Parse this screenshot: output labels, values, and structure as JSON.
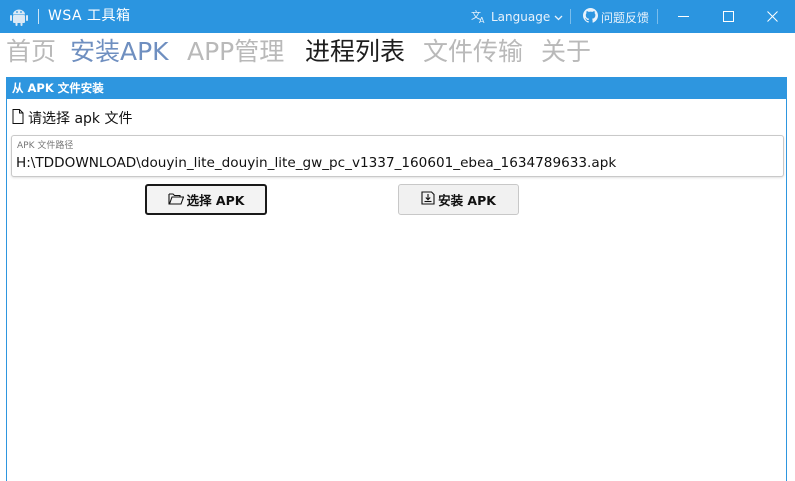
{
  "titlebar": {
    "title": "WSA 工具箱",
    "app_icon": "android-icon",
    "language_label": "Language",
    "feedback_label": "问题反馈",
    "bg_color": "#2b95e0"
  },
  "nav": {
    "items": [
      {
        "label": "首页",
        "state": "inactive"
      },
      {
        "label": "安装APK",
        "state": "hover"
      },
      {
        "label": "APP管理",
        "state": "inactive"
      },
      {
        "label": "进程列表",
        "state": "active"
      },
      {
        "label": "文件传输",
        "state": "inactive"
      },
      {
        "label": "关于",
        "state": "inactive"
      }
    ],
    "colors": {
      "active": "#1e1e1e",
      "hover": "#6f8fc0",
      "inactive": "#b9b9b9"
    }
  },
  "panel": {
    "header": "从 APK 文件安装",
    "subtitle": "请选择 apk 文件",
    "path_field": {
      "label": "APK 文件路径",
      "value": "H:\\TDDOWNLOAD\\douyin_lite_douyin_lite_gw_pc_v1337_160601_ebea_1634789633.apk"
    },
    "buttons": {
      "select": "选择 APK",
      "install": "安装 APK"
    },
    "accent_color": "#2e96df"
  }
}
